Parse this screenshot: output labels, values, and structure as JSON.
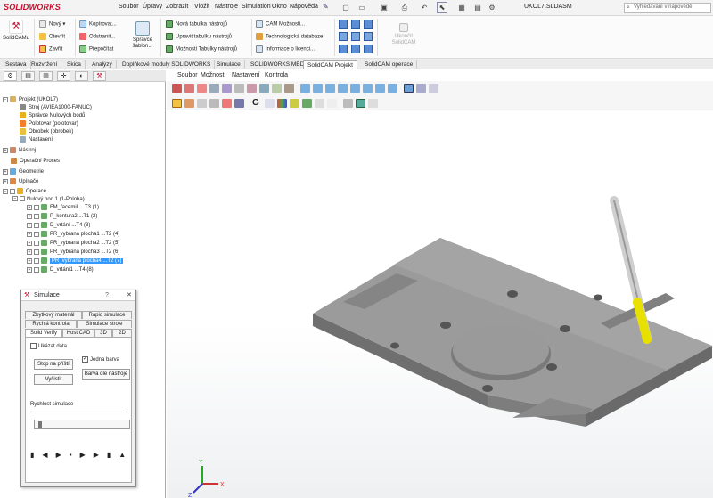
{
  "app": {
    "logo": "SOLIDWORKS",
    "document_title": "UKOL7.SLDASM",
    "search_placeholder": "Vyhledávání v nápovědě"
  },
  "menu": [
    "Soubor",
    "Úpravy",
    "Zobrazit",
    "Vložit",
    "Nástroje",
    "Simulation",
    "Okno",
    "Nápověda"
  ],
  "ribbon": {
    "solidcam": "SolidCAMu",
    "new": "Nový",
    "open": "Otevřít",
    "close": "Zavřít",
    "copy": "Kopírovat...",
    "remove": "Odstranit...",
    "recalc": "Přepočítat",
    "lib_manager": "Správce šablon...",
    "new_tool_table": "Nová tabulka nástrojů",
    "edit_tool_table": "Upravit tabulku nástrojů",
    "tool_table_options": "Možnosti Tabulky nástrojů",
    "cam_options": "CAM Možnosti...",
    "tech_db": "Technologická databáze",
    "license_info": "Informace o licenci...",
    "exit": "Ukončit SolidCAM"
  },
  "cm_tabs": [
    "Sestava",
    "Rozvržení",
    "Skica",
    "Analýzy",
    "Doplňkové moduly SOLIDWORKS",
    "Simulace",
    "SOLIDWORKS MBD",
    "SolidCAM Projekt",
    "SolidCAM operace"
  ],
  "cm_tab_active": "SolidCAM Projekt",
  "tree": {
    "project": "Projekt (UKOL7)",
    "machine": "Stroj (AVIEA1000-FANUC)",
    "origin_mgr": "Správce Nulových bodů",
    "stock": "Polotovar (polotovar)",
    "target": "Obrobek (obrobek)",
    "settings": "Nastavení",
    "tools": "Nástroj",
    "op_process": "Operační Proces",
    "geometry": "Geometrie",
    "fixtures": "Upínače",
    "operations": "Operace",
    "origin": "Nulový bod 1 (1-Poloha)",
    "ops": [
      "FM_facemill ...T3 (1)",
      "P_kontura2 ...T1 (2)",
      "D_vrtání ...T4 (3)",
      "PR_vybraná plocha1 ...T2 (4)",
      "PR_vybraná plocha2 ...T2 (5)",
      "PR_vybraná plocha3 ...T2 (6)",
      "PR_vybraná plocha4 ...T2 (7)",
      "D_vrtání1 ...T4 (8)"
    ],
    "selected_index": 6
  },
  "simulation": {
    "title": "Simulace",
    "tabs_row1": [
      "Zbytkový materiál",
      "Rapid simulace"
    ],
    "tabs_row2": [
      "Rychlá kontrola",
      "Simulace stroje"
    ],
    "tabs_row3": [
      "Solid Verify",
      "Host CAD",
      "3D",
      "2D"
    ],
    "show_data": "Ukázat data",
    "stop_next": "Stop na příští",
    "one_color": "Jedna barva",
    "exit": "Vyčistit",
    "tool_color": "Barva dle nástroje",
    "speed": "Rychlost simulace",
    "one_color_checked": true,
    "show_data_checked": false
  },
  "view_menu": [
    "Soubor",
    "Možnosti",
    "Nastavení",
    "Kontrola"
  ],
  "colors": {
    "part": "#8f8f8f",
    "tool_yellow": "#e8e000",
    "selected": "#3399ff",
    "brand": "#c8102e"
  }
}
